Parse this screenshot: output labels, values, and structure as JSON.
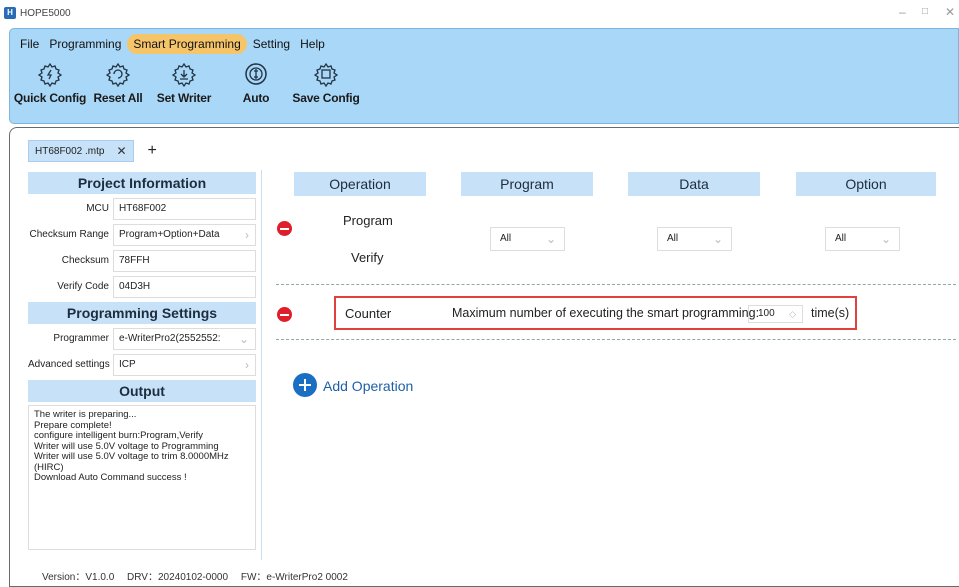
{
  "window": {
    "title": "HOPE5000",
    "controls": [
      "–",
      "□",
      "✕"
    ]
  },
  "menu": [
    "File",
    "Programming",
    "Smart Programming",
    "Setting",
    "Help"
  ],
  "menu_active": "Smart Programming",
  "toolbar": [
    {
      "label": "Quick Config",
      "icon": "gear-bolt-icon"
    },
    {
      "label": "Reset All",
      "icon": "gear-refresh-icon"
    },
    {
      "label": "Set Writer",
      "icon": "gear-download-icon"
    },
    {
      "label": "Auto",
      "icon": "auto-icon"
    },
    {
      "label": "Save Config",
      "icon": "gear-save-icon"
    }
  ],
  "tab": {
    "label": "HT68F002 .mtp",
    "close": "✕",
    "add": "+"
  },
  "project_info": {
    "heading": "Project Information",
    "fields": [
      {
        "label": "MCU",
        "value": "HT68F002"
      },
      {
        "label": "Checksum Range",
        "value": "Program+Option+Data"
      },
      {
        "label": "Checksum",
        "value": "78FFH"
      },
      {
        "label": "Verify Code",
        "value": "04D3H"
      }
    ]
  },
  "programming_settings": {
    "heading": "Programming Settings",
    "fields": [
      {
        "label": "Programmer",
        "value": "e-WriterPro2(2552552:"
      },
      {
        "label": "Advanced settings",
        "value": "ICP"
      }
    ]
  },
  "output": {
    "heading": "Output",
    "lines": [
      "The writer is preparing...",
      "Prepare complete!",
      "configure intelligent burn:Program,Verify",
      "Writer will use 5.0V voltage to Programming",
      "Writer will use 5.0V voltage to trim 8.0000MHz",
      "(HIRC)",
      "Download Auto Command success !"
    ]
  },
  "columns": [
    "Operation",
    "Program",
    "Data",
    "Option"
  ],
  "operations": {
    "op1": {
      "line1": "Program",
      "line2": "Verify"
    },
    "selects": [
      "All",
      "All",
      "All"
    ],
    "counter": {
      "label": "Counter",
      "description": "Maximum number of executing the smart programming:",
      "value": "100",
      "unit": "time(s)"
    }
  },
  "add_operation": "Add Operation",
  "status": {
    "version": "Version：V1.0.0",
    "drv": "DRV：20240102-0000",
    "fw": "FW：e-WriterPro2 0002"
  }
}
